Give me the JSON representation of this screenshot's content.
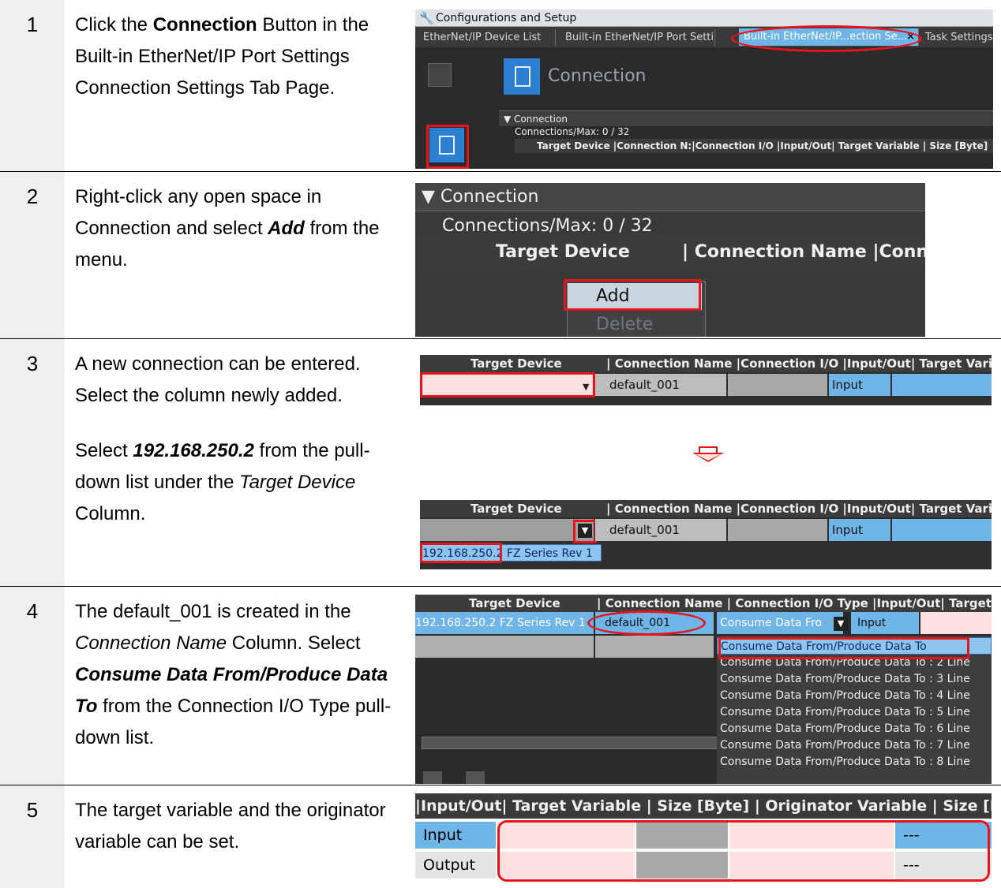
{
  "steps": [
    {
      "num": "1",
      "text": {
        "a": "Click the ",
        "b": "Connection",
        "c": " Button in the Built-in EtherNet/IP Port Settings Connection Settings Tab Page."
      },
      "shot": {
        "window_title": "Configurations and Setup",
        "tabs": [
          "EtherNet/IP Device List",
          "Built-in EtherNet/IP Port Setti...",
          "Built-in EtherNet/IP...ection Se...",
          "Task Settings"
        ],
        "tab_close": "×",
        "heading": "Connection",
        "section": "Connection",
        "count": "Connections/Max: 0 / 32",
        "columns": "Target Device |Connection N:|Connection I/O |Input/Out| Target Variable | Size [Byte]"
      }
    },
    {
      "num": "2",
      "text": {
        "a": "Right-click any open space in Connection and select ",
        "b": "Add",
        "c": " from the menu."
      },
      "shot": {
        "section": "Connection",
        "count": "Connections/Max: 0 / 32",
        "col_target": "Target Device",
        "col_name": "| Connection Name |Connec",
        "menu_add": "Add",
        "menu_delete": "Delete"
      }
    },
    {
      "num": "3",
      "text": {
        "a": "A new connection can be entered. Select the column newly added.",
        "b_pre": "Select ",
        "b_ip": "192.168.250.2",
        "b_mid": " from the pull-down list under the ",
        "b_col": "Target Device",
        "b_post": " Column."
      },
      "shot": {
        "columns": "| Connection Name |Connection I/O |Input/Out| Target Variable",
        "col_target": "Target Device",
        "name": "default_001",
        "io": "Input",
        "option": "192.168.250.2 FZ Series Rev 1"
      }
    },
    {
      "num": "4",
      "text": {
        "a": "The default_001 is created in the ",
        "b": "Connection Name",
        "c": " Column. Select ",
        "d": "Consume Data From/Produce Data To",
        "e": " from the Connection I/O Type pull-down list."
      },
      "shot": {
        "col_target": "Target Device",
        "columns": "| Connection Name | Connection I/O Type |Input/Out| Target Vari",
        "device": "192.168.250.2 FZ Series Rev 1",
        "name": "default_001",
        "io_type": "Consume Data Fro",
        "io": "Input",
        "options": [
          "Consume Data From/Produce Data To",
          "Consume Data From/Produce Data To : 2 Line",
          "Consume Data From/Produce Data To : 3 Line",
          "Consume Data From/Produce Data To : 4 Line",
          "Consume Data From/Produce Data To : 5 Line",
          "Consume Data From/Produce Data To : 6 Line",
          "Consume Data From/Produce Data To : 7 Line",
          "Consume Data From/Produce Data To : 8 Line"
        ]
      }
    },
    {
      "num": "5",
      "text": {
        "a": "The target variable and the originator variable can be set."
      },
      "shot": {
        "columns": "|Input/Out| Target Variable | Size [Byte] | Originator Variable | Size [Byte]",
        "row1": "Input",
        "row2": "Output",
        "dash": "---"
      }
    }
  ],
  "colors": {
    "accent_red": "#e8141b",
    "selection_blue": "#6fb5e8",
    "pink_cell": "#fde0e0",
    "gray_cell": "#a9a9a9",
    "step_bg": "#efefef"
  }
}
